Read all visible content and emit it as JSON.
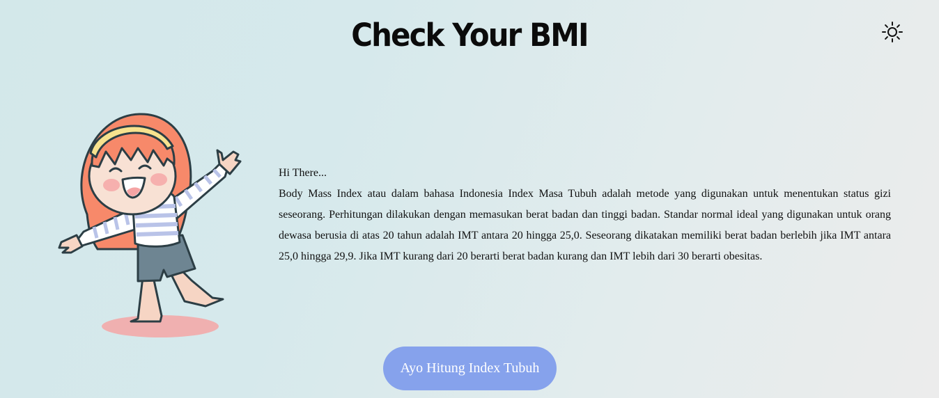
{
  "header": {
    "title": "Check Your BMI",
    "theme_toggle_icon": "sun-icon"
  },
  "intro": {
    "greeting": "Hi There...",
    "paragraph": "Body Mass Index atau dalam bahasa Indonesia Index Masa Tubuh adalah metode yang digunakan untuk menentukan status gizi seseorang. Perhitungan dilakukan dengan memasukan berat badan dan tinggi badan. Standar normal ideal yang digunakan untuk orang dewasa berusia di atas 20 tahun adalah IMT antara 20 hingga 25,0. Seseorang dikatakan memiliki berat badan berlebih jika IMT antara 25,0 hingga 29,9. Jika IMT kurang dari 20 berarti berat badan kurang dan IMT lebih dari 30 berarti obesitas."
  },
  "cta": {
    "label": "Ayo Hitung Index Tubuh"
  },
  "illustration": {
    "icon": "happy-girl-illustration"
  },
  "colors": {
    "button": "#86a2ec",
    "hair": "#f7896a",
    "headband": "#f7e28e",
    "shirt_stripe": "#b9c3e8",
    "shorts": "#6e8592",
    "shadow": "#f0b0b0"
  }
}
